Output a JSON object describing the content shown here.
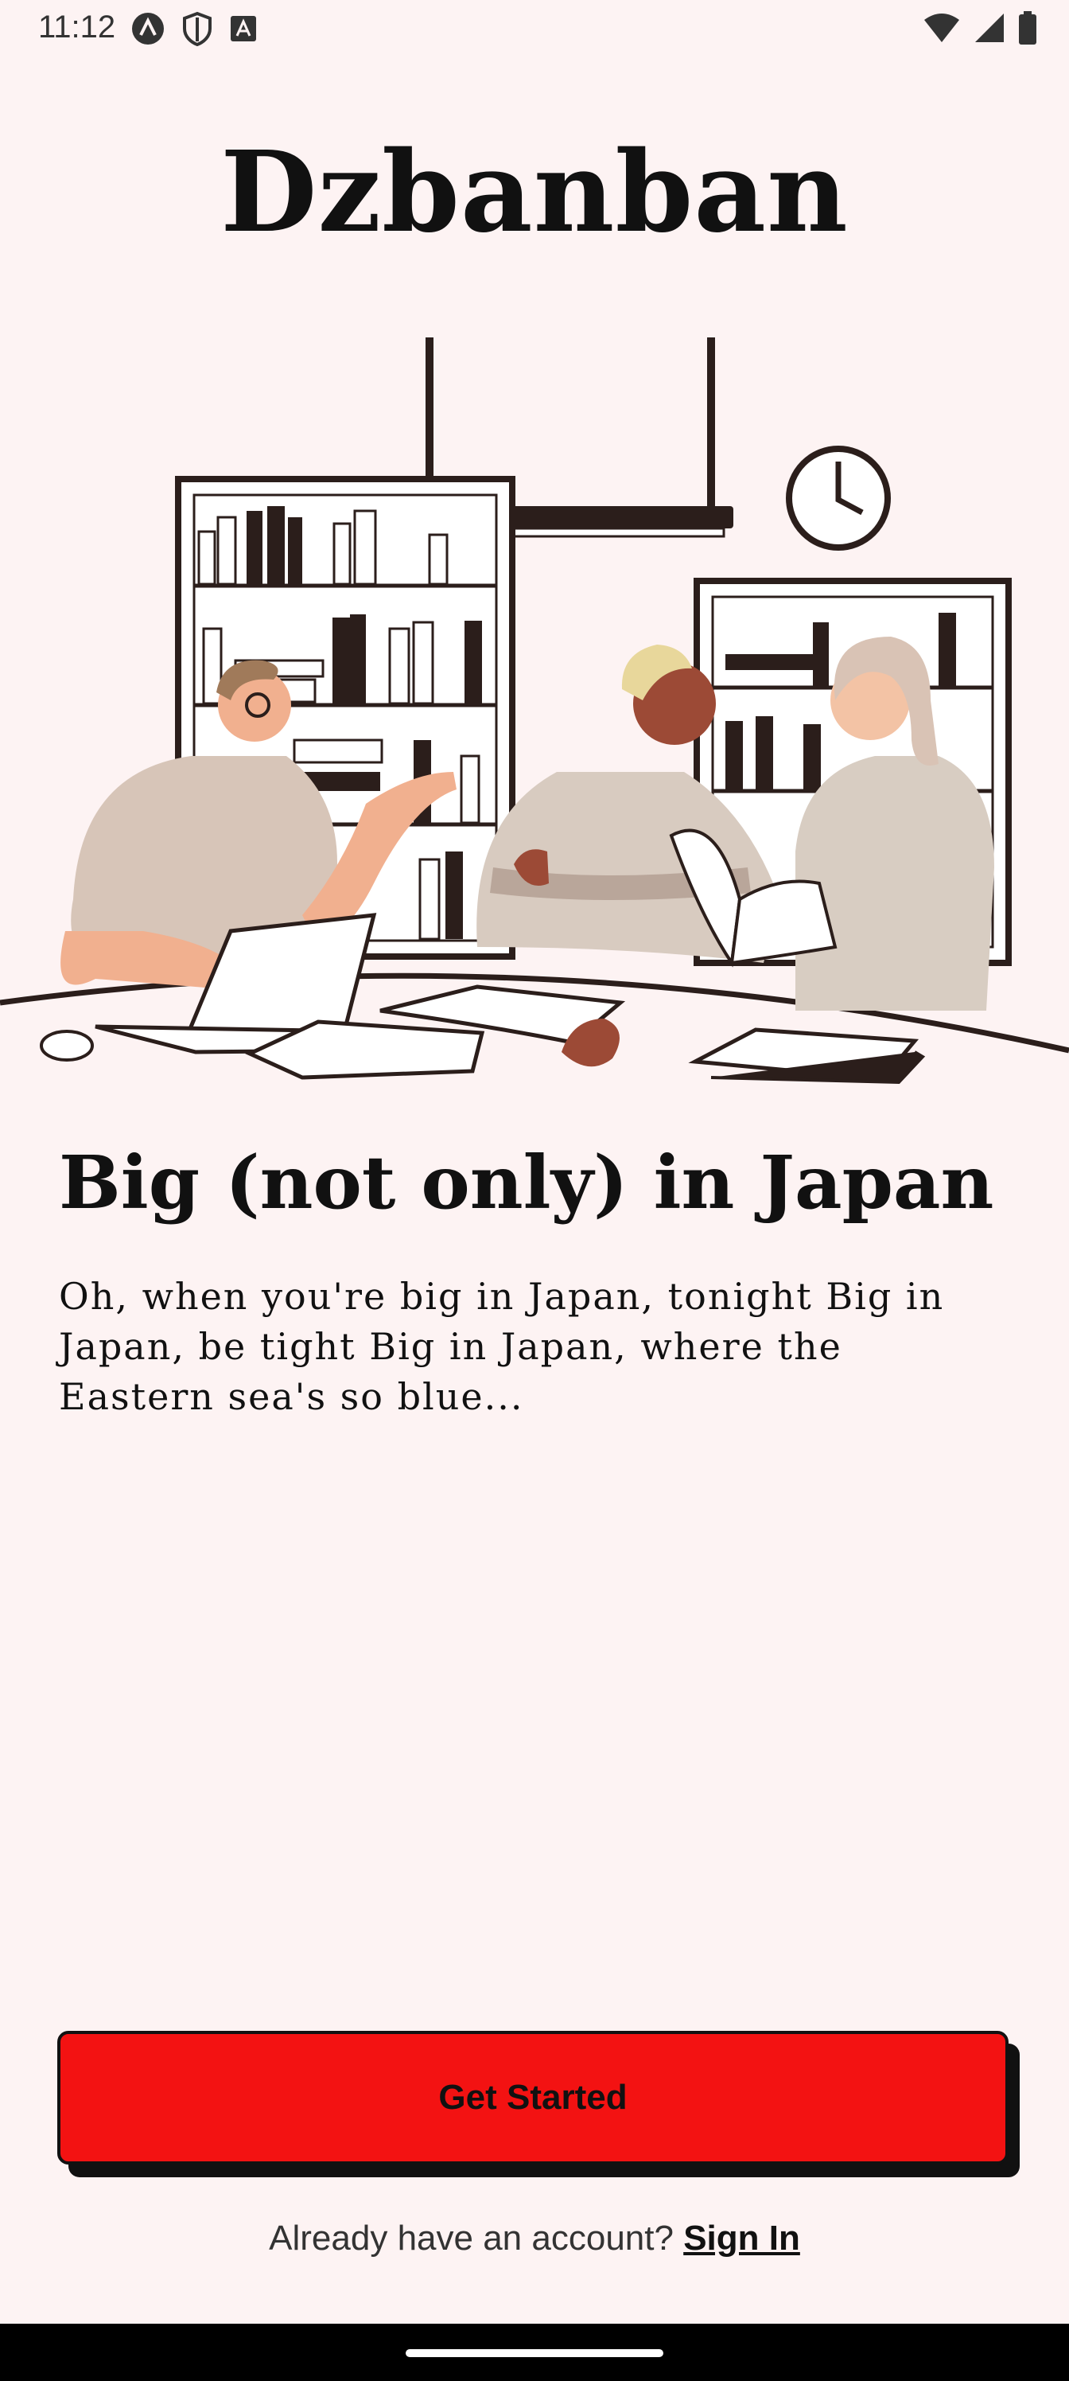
{
  "status_bar": {
    "time": "11:12",
    "icons": [
      "app-badge-icon",
      "shield-icon",
      "keyboard-a-icon",
      "wifi-icon",
      "signal-icon",
      "battery-icon"
    ]
  },
  "app": {
    "title": "Dzbanban"
  },
  "illustration": {
    "icon": "study-group-illustration"
  },
  "content": {
    "headline": "Big (not only) in Japan",
    "description": "Oh, when you're big in Japan, tonight Big in Japan, be tight Big in Japan, where the Eastern sea's so blue..."
  },
  "actions": {
    "get_started_label": "Get Started",
    "signin_prompt": "Already have an account? ",
    "signin_label": "Sign In"
  },
  "colors": {
    "background": "#fdf3f3",
    "accent": "#f31212",
    "ink": "#111111"
  }
}
